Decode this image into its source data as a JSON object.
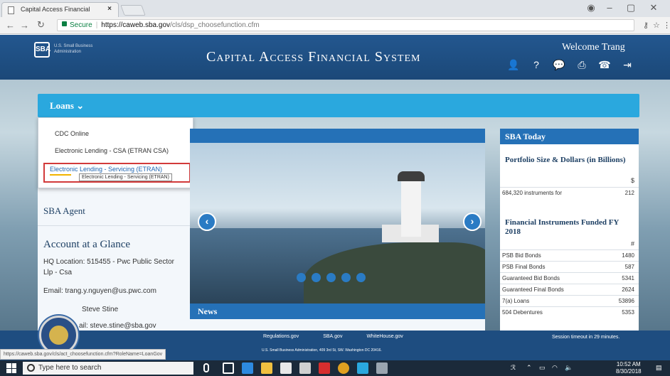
{
  "browser": {
    "tab_title": "Capital Access Financial",
    "address_secure": "Secure",
    "url_host": "https://caweb.sba.gov",
    "url_path": "/cls/dsp_choosefunction.cfm"
  },
  "header": {
    "app_title": "Capital Access Financial System",
    "welcome": "Welcome Trang",
    "logo_text": "SBA",
    "logo_sub": "U.S. Small Business Administration"
  },
  "nav": {
    "loans_label": "Loans"
  },
  "dropdown": {
    "items": [
      "CDC Online",
      "Electronic Lending - CSA (ETRAN CSA)",
      "Electronic Lending - Servicing (ETRAN)"
    ],
    "tooltip": "Electronic Lending - Servicing (ETRAN)"
  },
  "left_panel": {
    "agent_title": "SBA Agent",
    "account_title": "Account at a Glance",
    "hq_location": "HQ Location: 515455 - Pwc Public Sector Llp - Csa",
    "email": "Email: trang.y.nguyen@us.pwc.com",
    "ao_line": "Steve Stine",
    "email2_fragment": "ail: steve.stine@sba.gov"
  },
  "news": {
    "title": "News"
  },
  "sba_today": {
    "title": "SBA Today",
    "portfolio_title": "Portfolio Size & Dollars (in Billions)",
    "portfolio_unit": "$",
    "portfolio_row_label": "684,320 instruments for",
    "portfolio_row_value": "212",
    "funded_title": "Financial Instruments Funded FY 2018",
    "funded_unit": "#",
    "rows": [
      {
        "label": "PSB Bid Bonds",
        "value": "1480"
      },
      {
        "label": "PSB Final Bonds",
        "value": "587"
      },
      {
        "label": "Guaranteed Bid Bonds",
        "value": "5341"
      },
      {
        "label": "Guaranteed Final Bonds",
        "value": "2624"
      },
      {
        "label": "7(a) Loans",
        "value": "53896"
      },
      {
        "label": "504 Debentures",
        "value": "5353"
      }
    ]
  },
  "footer": {
    "links": [
      "Regulations.gov",
      "SBA.gov",
      "WhiteHouse.gov"
    ],
    "address": "U.S. Small Business Administration, 409 3rd St, SW. Washington DC 20416.",
    "session": "Session timeout in 29 minutes."
  },
  "status_url": "https://caweb.sba.gov/cls/act_choosefunction.cfm?RoleName=LoanGov",
  "taskbar": {
    "search_placeholder": "Type here to search",
    "time": "10:52 AM",
    "date": "8/30/2018"
  }
}
